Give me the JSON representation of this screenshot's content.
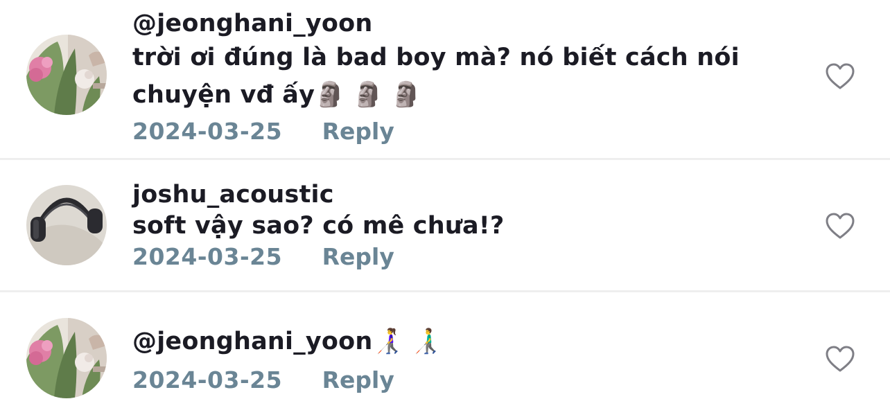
{
  "comments": [
    {
      "username": "@jeonghani_yoon",
      "text": "trời ơi đúng là bad boy mà? nó biết cách nói chuyện vđ ấy",
      "emoji": "🗿 🗿 🗿",
      "date": "2024-03-25",
      "reply_label": "Reply",
      "avatar": "flower-bouquet-avatar",
      "like_icon": "heart-outline-icon"
    },
    {
      "username": "joshu_acoustic",
      "text": "soft vậy sao? có mê chưa!?",
      "emoji": "",
      "date": "2024-03-25",
      "reply_label": "Reply",
      "avatar": "headphones-avatar",
      "like_icon": "heart-outline-icon"
    },
    {
      "username": "@jeonghani_yoon",
      "text": "",
      "emoji": "👩‍🦯 👨‍🦯",
      "date": "2024-03-25",
      "reply_label": "Reply",
      "avatar": "flower-bouquet-avatar",
      "like_icon": "heart-outline-icon"
    }
  ],
  "colors": {
    "text": "#1b1b24",
    "meta": "#6a8595",
    "divider": "#eeeeee",
    "icon": "#7f7f86"
  }
}
